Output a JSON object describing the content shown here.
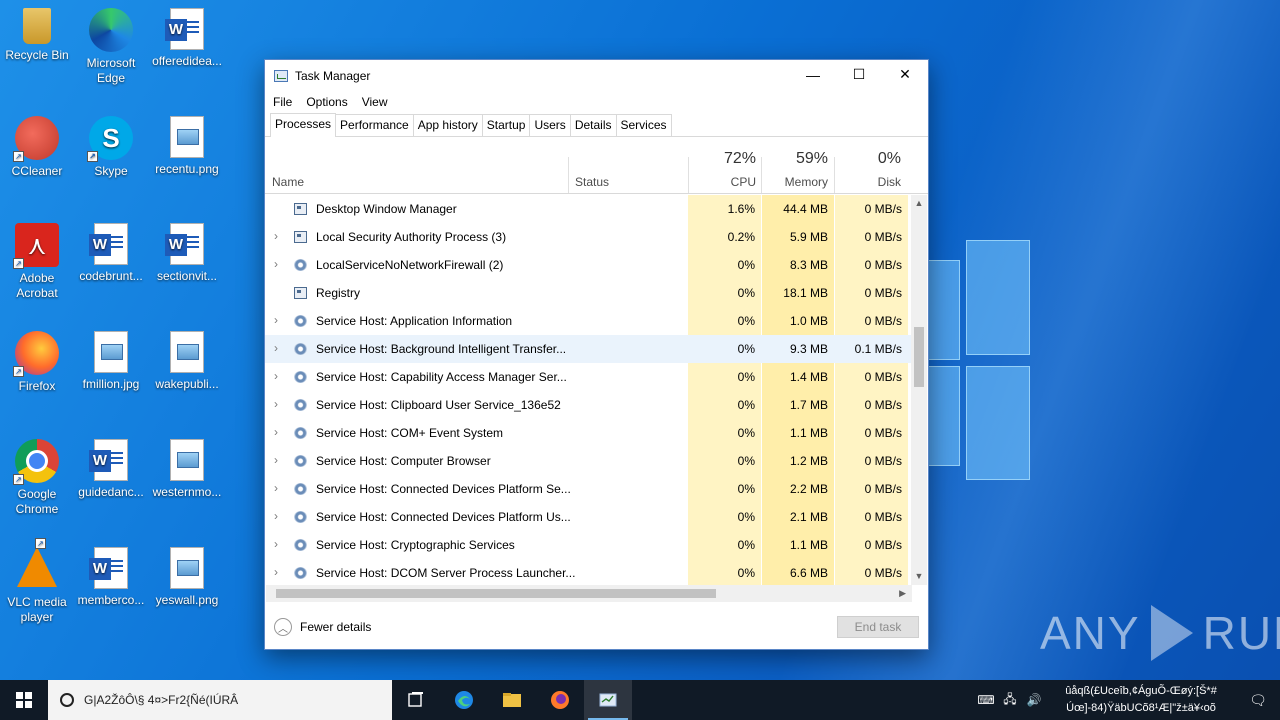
{
  "desktop": {
    "icons": [
      {
        "label": "Recycle Bin",
        "icon": "recycle-bin-icon"
      },
      {
        "label": "Microsoft Edge",
        "icon": "edge-icon"
      },
      {
        "label": "offeredidea...",
        "icon": "word-doc-icon"
      },
      {
        "label": "CCleaner",
        "icon": "ccleaner-icon"
      },
      {
        "label": "Skype",
        "icon": "skype-icon"
      },
      {
        "label": "recentu.png",
        "icon": "image-file-icon"
      },
      {
        "label": "Adobe Acrobat",
        "icon": "acrobat-icon"
      },
      {
        "label": "codebrunt...",
        "icon": "word-doc-icon"
      },
      {
        "label": "sectionvit...",
        "icon": "word-doc-icon"
      },
      {
        "label": "Firefox",
        "icon": "firefox-icon"
      },
      {
        "label": "fmillion.jpg",
        "icon": "image-file-icon"
      },
      {
        "label": "wakepubli...",
        "icon": "image-file-icon"
      },
      {
        "label": "Google Chrome",
        "icon": "chrome-icon"
      },
      {
        "label": "guidedanc...",
        "icon": "word-doc-icon"
      },
      {
        "label": "westernmo...",
        "icon": "image-file-icon"
      },
      {
        "label": "VLC media player",
        "icon": "vlc-icon"
      },
      {
        "label": "memberco...",
        "icon": "word-doc-icon"
      },
      {
        "label": "yeswall.png",
        "icon": "image-file-icon"
      }
    ]
  },
  "taskmanager": {
    "title": "Task Manager",
    "window_buttons": {
      "minimize": "—",
      "maximize": "☐",
      "close": "✕"
    },
    "menu": [
      "File",
      "Options",
      "View"
    ],
    "tabs": [
      "Processes",
      "Performance",
      "App history",
      "Startup",
      "Users",
      "Details",
      "Services"
    ],
    "active_tab": "Processes",
    "columns": {
      "name": "Name",
      "status": "Status",
      "cpu": {
        "label": "CPU",
        "percent": "72%"
      },
      "memory": {
        "label": "Memory",
        "percent": "59%"
      },
      "disk": {
        "label": "Disk",
        "percent": "0%"
      }
    },
    "processes": [
      {
        "name": "Desktop Window Manager",
        "expand": "",
        "icon": "window-icon",
        "cpu": "1.6%",
        "mem": "44.4 MB",
        "disk": "0 MB/s"
      },
      {
        "name": "Local Security Authority Process (3)",
        "expand": "›",
        "icon": "window-icon",
        "cpu": "0.2%",
        "mem": "5.9 MB",
        "disk": "0 MB/s"
      },
      {
        "name": "LocalServiceNoNetworkFirewall (2)",
        "expand": "›",
        "icon": "gear-icon",
        "cpu": "0%",
        "mem": "8.3 MB",
        "disk": "0 MB/s"
      },
      {
        "name": "Registry",
        "expand": "",
        "icon": "window-icon",
        "cpu": "0%",
        "mem": "18.1 MB",
        "disk": "0 MB/s"
      },
      {
        "name": "Service Host: Application Information",
        "expand": "›",
        "icon": "gear-icon",
        "cpu": "0%",
        "mem": "1.0 MB",
        "disk": "0 MB/s"
      },
      {
        "name": "Service Host: Background Intelligent Transfer...",
        "expand": "›",
        "icon": "gear-icon",
        "cpu": "0%",
        "mem": "9.3 MB",
        "disk": "0.1 MB/s"
      },
      {
        "name": "Service Host: Capability Access Manager Ser...",
        "expand": "›",
        "icon": "gear-icon",
        "cpu": "0%",
        "mem": "1.4 MB",
        "disk": "0 MB/s"
      },
      {
        "name": "Service Host: Clipboard User Service_136e52",
        "expand": "›",
        "icon": "gear-icon",
        "cpu": "0%",
        "mem": "1.7 MB",
        "disk": "0 MB/s"
      },
      {
        "name": "Service Host: COM+ Event System",
        "expand": "›",
        "icon": "gear-icon",
        "cpu": "0%",
        "mem": "1.1 MB",
        "disk": "0 MB/s"
      },
      {
        "name": "Service Host: Computer Browser",
        "expand": "›",
        "icon": "gear-icon",
        "cpu": "0%",
        "mem": "1.2 MB",
        "disk": "0 MB/s"
      },
      {
        "name": "Service Host: Connected Devices Platform Se...",
        "expand": "›",
        "icon": "gear-icon",
        "cpu": "0%",
        "mem": "2.2 MB",
        "disk": "0 MB/s"
      },
      {
        "name": "Service Host: Connected Devices Platform Us...",
        "expand": "›",
        "icon": "gear-icon",
        "cpu": "0%",
        "mem": "2.1 MB",
        "disk": "0 MB/s"
      },
      {
        "name": "Service Host: Cryptographic Services",
        "expand": "›",
        "icon": "gear-icon",
        "cpu": "0%",
        "mem": "1.1 MB",
        "disk": "0 MB/s"
      },
      {
        "name": "Service Host: DCOM Server Process Launcher...",
        "expand": "›",
        "icon": "gear-icon",
        "cpu": "0%",
        "mem": "6.6 MB",
        "disk": "0 MB/s"
      }
    ],
    "highlighted_row": 5,
    "fewer_details": "Fewer details",
    "end_task": "End task"
  },
  "taskbar": {
    "search_text": "G|A2ŽôÔ\\§ 4¤>Fr2{Ñé(IÚRÂ",
    "apps": [
      "task-view-icon",
      "edge-icon",
      "file-explorer-icon",
      "firefox-icon",
      "task-manager-icon"
    ],
    "active_app": "task-manager-icon",
    "clock_line1": "ûåqß(£Uceîb,¢ÁguÕ-Œøý:[Š*#",
    "clock_line2": "Úœ]-84)ŸäbUCõ8¹Æ|\"ž±ä¥‹oõ"
  },
  "watermark": {
    "left": "ANY",
    "right": "RUN"
  },
  "colors": {
    "wallpaper": "#0a6fd4",
    "cpu_column": "#fff4c4",
    "memory_column": "#ffeeaa",
    "row_highlight": "#eaf3fc",
    "taskbar": "#101a26"
  }
}
